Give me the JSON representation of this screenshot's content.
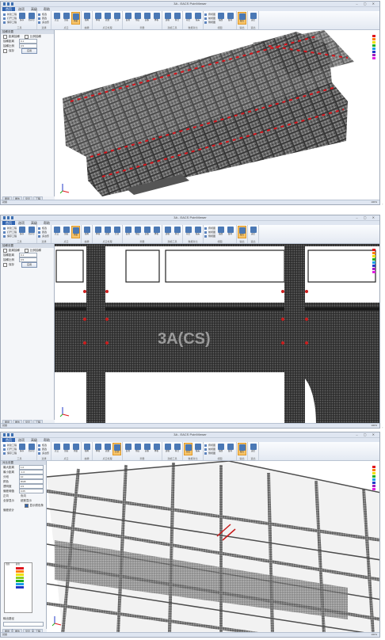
{
  "shots": [
    {
      "title": "3A - EACS PointViewer",
      "menu": [
        "首页",
        "选项",
        "高级",
        "帮助"
      ],
      "ribbon_groups": [
        {
          "label": "工具",
          "small": [
            "新建工程",
            "打开工程",
            "保存工程"
          ],
          "buttons": [
            {
              "label": "保存"
            },
            {
              "label": "另存为"
            }
          ]
        },
        {
          "label": "选择",
          "small": [
            "框选",
            "圆选",
            "多边形"
          ],
          "buttons": []
        },
        {
          "label": "点云",
          "small": [],
          "buttons": [
            {
              "label": "点云"
            },
            {
              "label": "剖面"
            },
            {
              "label": "测量",
              "highlight": true
            }
          ]
        },
        {
          "label": "抽稀",
          "small": [],
          "buttons": [
            {
              "label": "抽稀"
            }
          ]
        },
        {
          "label": "点云处理",
          "small": [],
          "buttons": [
            {
              "label": "降噪"
            },
            {
              "label": "滤波"
            },
            {
              "label": "分割"
            }
          ]
        },
        {
          "label": "测量",
          "small": [],
          "buttons": [
            {
              "label": "距离"
            },
            {
              "label": "角度"
            },
            {
              "label": "面积"
            },
            {
              "label": "体积"
            }
          ]
        },
        {
          "label": "建模工具",
          "small": [],
          "buttons": [
            {
              "label": "建模"
            },
            {
              "label": "拟合"
            }
          ]
        },
        {
          "label": "数据对比",
          "small": [],
          "buttons": [
            {
              "label": "对比"
            },
            {
              "label": "偏差"
            }
          ]
        },
        {
          "label": "视图",
          "small": [
            "俯视图",
            "前视图",
            "侧视图"
          ],
          "buttons": [
            {
              "label": "缩放"
            },
            {
              "label": "旋转"
            }
          ]
        },
        {
          "label": "输出",
          "small": [],
          "buttons": [
            {
              "label": "报告",
              "highlight": true
            }
          ]
        },
        {
          "label": "退出",
          "small": [],
          "buttons": [
            {
              "label": "退出"
            }
          ]
        }
      ],
      "panel": {
        "title": "抽稀设置",
        "rows": [
          {
            "type": "check",
            "label": "距离抽稀",
            "label2": "比例抽稀"
          },
          {
            "type": "input",
            "label": "抽稀距离",
            "value": "0.1"
          },
          {
            "type": "input",
            "label": "抽稀比例",
            "value": "0.5"
          },
          {
            "type": "button",
            "label": "保存",
            "button": "应用"
          }
        ]
      },
      "status": "就绪",
      "tabs": [
        "图层",
        "属性",
        "显示",
        "工程"
      ],
      "status_right": "100%"
    },
    {
      "title": "3A - EACS PointViewer",
      "menu": [
        "首页",
        "选项",
        "高级",
        "帮助"
      ],
      "ribbon_groups": [
        {
          "label": "工具",
          "small": [
            "新建工程",
            "打开工程",
            "保存工程"
          ],
          "buttons": [
            {
              "label": "保存"
            },
            {
              "label": "另存为"
            }
          ]
        },
        {
          "label": "选择",
          "small": [
            "框选",
            "圆选",
            "多边形"
          ],
          "buttons": []
        },
        {
          "label": "点云",
          "small": [],
          "buttons": [
            {
              "label": "点云"
            },
            {
              "label": "剖面"
            },
            {
              "label": "测量",
              "highlight": true
            }
          ]
        },
        {
          "label": "抽稀",
          "small": [],
          "buttons": [
            {
              "label": "抽稀"
            }
          ]
        },
        {
          "label": "点云处理",
          "small": [],
          "buttons": [
            {
              "label": "降噪"
            },
            {
              "label": "滤波"
            },
            {
              "label": "分割"
            }
          ]
        },
        {
          "label": "测量",
          "small": [],
          "buttons": [
            {
              "label": "距离"
            },
            {
              "label": "角度"
            },
            {
              "label": "面积"
            },
            {
              "label": "体积"
            }
          ]
        },
        {
          "label": "建模工具",
          "small": [],
          "buttons": [
            {
              "label": "建模"
            },
            {
              "label": "拟合"
            }
          ]
        },
        {
          "label": "数据对比",
          "small": [],
          "buttons": [
            {
              "label": "对比"
            },
            {
              "label": "偏差"
            }
          ]
        },
        {
          "label": "视图",
          "small": [
            "俯视图",
            "前视图",
            "侧视图"
          ],
          "buttons": [
            {
              "label": "缩放"
            },
            {
              "label": "旋转"
            }
          ]
        },
        {
          "label": "输出",
          "small": [],
          "buttons": [
            {
              "label": "报告",
              "highlight": true
            }
          ]
        },
        {
          "label": "退出",
          "small": [],
          "buttons": [
            {
              "label": "退出"
            }
          ]
        }
      ],
      "panel": {
        "title": "抽稀设置",
        "rows": [
          {
            "type": "check",
            "label": "距离抽稀",
            "label2": "比例抽稀"
          },
          {
            "type": "input",
            "label": "抽稀距离",
            "value": "0.1"
          },
          {
            "type": "input",
            "label": "抽稀比例",
            "value": "0.5"
          },
          {
            "type": "button",
            "label": "保存",
            "button": "应用"
          }
        ]
      },
      "viewport_text": "3A(CS)",
      "status": "就绪",
      "tabs": [
        "图层",
        "属性",
        "显示",
        "工程"
      ],
      "status_right": "100%"
    },
    {
      "title": "3A - EACS PointViewer",
      "menu": [
        "首页",
        "选项",
        "高级",
        "帮助"
      ],
      "ribbon_groups": [
        {
          "label": "工具",
          "small": [
            "新建工程",
            "打开工程",
            "保存工程"
          ],
          "buttons": [
            {
              "label": "保存"
            },
            {
              "label": "另存为"
            }
          ]
        },
        {
          "label": "选择",
          "small": [
            "框选",
            "圆选",
            "多边形"
          ],
          "buttons": []
        },
        {
          "label": "点云",
          "small": [],
          "buttons": [
            {
              "label": "点云"
            },
            {
              "label": "剖面"
            },
            {
              "label": "测量"
            }
          ]
        },
        {
          "label": "抽稀",
          "small": [],
          "buttons": [
            {
              "label": "抽稀"
            }
          ]
        },
        {
          "label": "点云处理",
          "small": [],
          "buttons": [
            {
              "label": "降噪"
            },
            {
              "label": "滤波"
            },
            {
              "label": "分割",
              "highlight": true
            }
          ]
        },
        {
          "label": "测量",
          "small": [],
          "buttons": [
            {
              "label": "距离"
            },
            {
              "label": "角度"
            },
            {
              "label": "面积"
            },
            {
              "label": "体积"
            }
          ]
        },
        {
          "label": "建模工具",
          "small": [],
          "buttons": [
            {
              "label": "建模"
            },
            {
              "label": "拟合"
            }
          ]
        },
        {
          "label": "数据对比",
          "small": [],
          "buttons": [
            {
              "label": "对比",
              "highlight": true
            },
            {
              "label": "偏差"
            }
          ]
        },
        {
          "label": "视图",
          "small": [
            "俯视图",
            "前视图",
            "侧视图"
          ],
          "buttons": [
            {
              "label": "缩放"
            },
            {
              "label": "旋转"
            }
          ]
        },
        {
          "label": "输出",
          "small": [],
          "buttons": [
            {
              "label": "报告",
              "highlight": true
            }
          ]
        },
        {
          "label": "退出",
          "small": [],
          "buttons": [
            {
              "label": "退出"
            }
          ]
        }
      ],
      "panel3": {
        "title": "对比设置",
        "fields": [
          {
            "label": "最大距离",
            "value": "1.0"
          },
          {
            "label": "最小距离",
            "value": "-1.0"
          },
          {
            "label": "分段",
            "value": "10"
          },
          {
            "label": "颜色",
            "value": "RGB"
          },
          {
            "label": "透明度",
            "value": "0.5"
          },
          {
            "label": "偏差阈值",
            "value": "0.05"
          }
        ],
        "options": [
          "正向",
          "负向"
        ],
        "options2": [
          "全部显示",
          "超差显示"
        ],
        "checkbox": "显示颜色条",
        "legend_title": "偏差统计",
        "legend_cols": [
          "范围",
          "颜色"
        ],
        "output_label": "输出路径",
        "buttons": [
          "确定",
          "取消"
        ]
      },
      "status": "就绪",
      "tabs": [
        "图层",
        "属性",
        "显示",
        "工程"
      ],
      "status_right": "100%"
    }
  ],
  "palette_colors": [
    "#e0161c",
    "#ff7f0e",
    "#f0e000",
    "#20b020",
    "#1aa0e8",
    "#2038c8",
    "#a020c0",
    "#e020e0"
  ],
  "legend_colors": [
    "#e0161c",
    "#ff7f0e",
    "#f0e000",
    "#90d020",
    "#20b020",
    "#1aa0e8",
    "#2038c8"
  ]
}
